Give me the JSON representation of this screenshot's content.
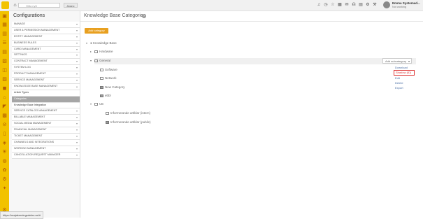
{
  "topbar": {
    "search_placeholder": "Hitta nytt",
    "advanced_label": "Avanc",
    "user_name": "Emma Systemad...",
    "user_status": "Not working"
  },
  "sidebar": {
    "title": "Configurations",
    "items": [
      {
        "label": "MANAGE",
        "state": "closed"
      },
      {
        "label": "USER & PERMISSION MANAGEMENT",
        "state": "closed"
      },
      {
        "label": "ENTITY MANAGEMENT",
        "state": "closed"
      },
      {
        "label": "BUSINESS RULES",
        "state": "closed"
      },
      {
        "label": "CI/RID MANAGEMENT",
        "state": "closed"
      },
      {
        "label": "SETTINGS",
        "state": "closed"
      },
      {
        "label": "CONTRACT MANAGEMENT",
        "state": "closed"
      },
      {
        "label": "SYSTEM LOG",
        "state": "closed"
      },
      {
        "label": "PRODUCT MANAGEMENT",
        "state": "closed"
      },
      {
        "label": "SERVICE MANAGEMENT",
        "state": "closed"
      },
      {
        "label": "KNOWLEDGE BASE MANAGEMENT",
        "state": "open"
      },
      {
        "label": "Article Types",
        "state": "sub"
      },
      {
        "label": "Categories",
        "state": "active"
      },
      {
        "label": "Knowledge Base Integration",
        "state": "sub"
      },
      {
        "label": "SERVICE CATALOG MANAGEMENT",
        "state": "closed"
      },
      {
        "label": "BILLABLE MANAGEMENT",
        "state": "closed"
      },
      {
        "label": "SOCIAL MEDIA MANAGEMENT",
        "state": "closed"
      },
      {
        "label": "FINANCIAL MANAGEMENT",
        "state": "closed"
      },
      {
        "label": "TICKET MANAGEMENT",
        "state": "closed"
      },
      {
        "label": "CHANNELS AND INTEGRATIONS",
        "state": "closed"
      },
      {
        "label": "WORKING MANAGEMENT",
        "state": "closed"
      },
      {
        "label": "CANCELLATION REQUEST MANAGER",
        "state": "closed"
      }
    ]
  },
  "main": {
    "title": "Knowledge Base Categories",
    "add_button": "Add category",
    "tree": [
      {
        "label": "Knowledge Base",
        "level": 0,
        "toggle": "▾",
        "icon": "dot"
      },
      {
        "label": "Hardware",
        "level": 1,
        "toggle": "▸",
        "icon": "folder"
      },
      {
        "label": "General",
        "level": 1,
        "toggle": "▾",
        "icon": "folder"
      },
      {
        "label": "Software",
        "level": 2,
        "toggle": "",
        "icon": "folder"
      },
      {
        "label": "Network",
        "level": 2,
        "toggle": "",
        "icon": "folder"
      },
      {
        "label": "New Category",
        "level": 2,
        "toggle": "",
        "icon": "folder-filled"
      },
      {
        "label": "ebbl",
        "level": 2,
        "toggle": "",
        "icon": "folder-filled"
      },
      {
        "label": "UE",
        "level": 1,
        "toggle": "▾",
        "icon": "folder"
      },
      {
        "label": "Informerande artiklar (intern)",
        "level": 2,
        "toggle": "",
        "icon": "folder"
      },
      {
        "label": "Informerande artiklar (public)",
        "level": 2,
        "toggle": "",
        "icon": "folder-filled"
      }
    ],
    "dropdown_button": "Add subcategory",
    "dropdown_items": [
      "Download",
      "Shadow (ID)",
      "Edit",
      "Delete",
      "Export"
    ]
  },
  "status_url": "https://majakerningsdeles.se/#"
}
